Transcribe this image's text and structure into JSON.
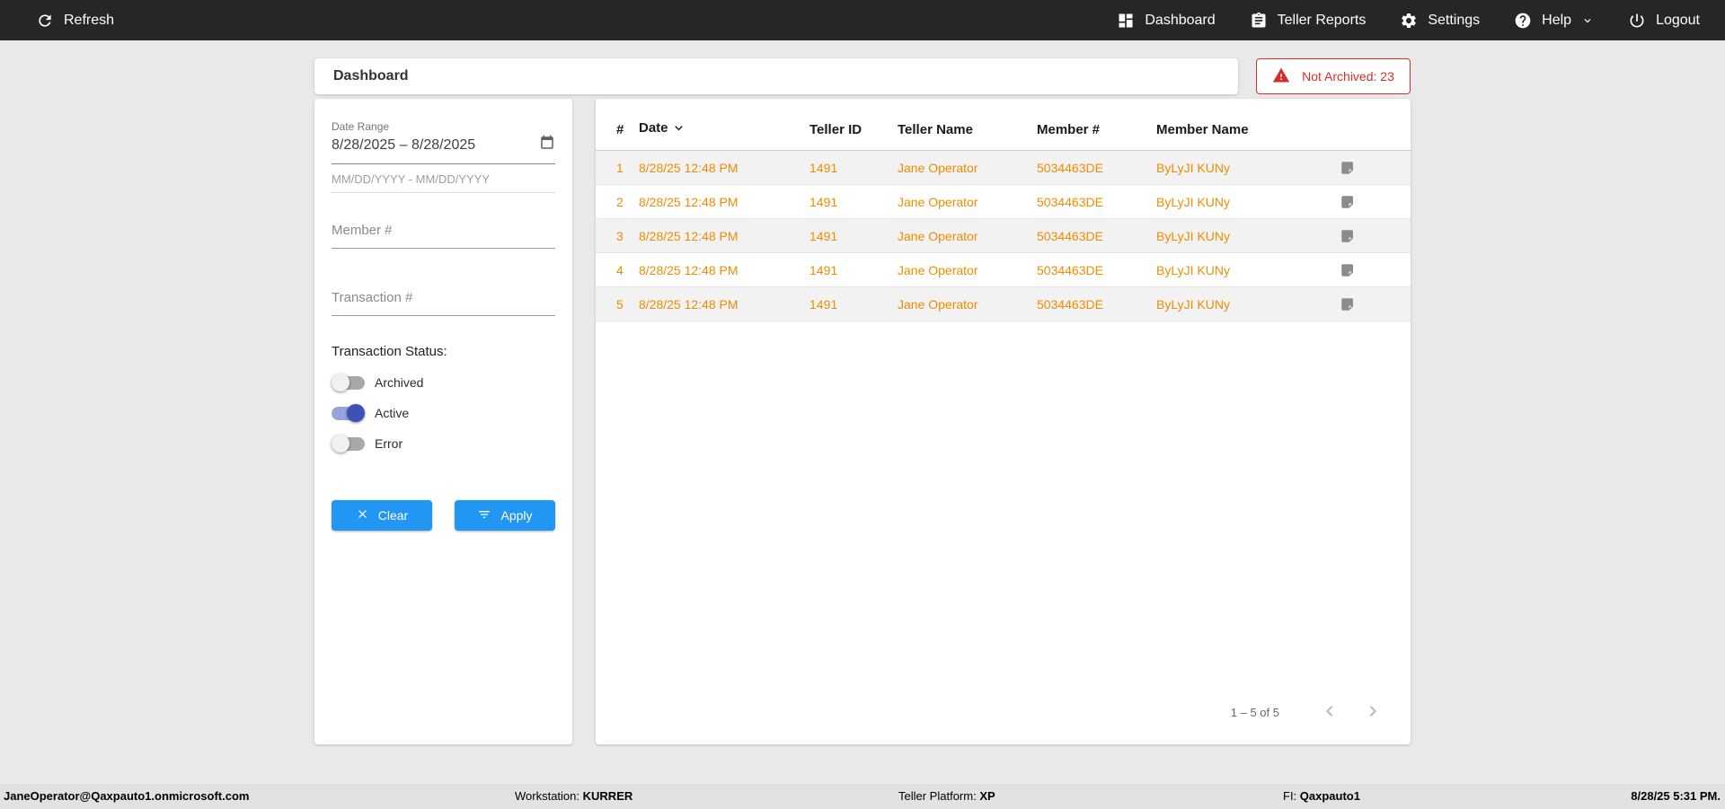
{
  "topbar": {
    "refresh_label": "Refresh",
    "nav": {
      "dashboard": "Dashboard",
      "teller_reports": "Teller Reports",
      "settings": "Settings",
      "help": "Help",
      "logout": "Logout"
    }
  },
  "header": {
    "title": "Dashboard",
    "not_archived_badge": "Not Archived: 23"
  },
  "filters": {
    "date_range_label": "Date Range",
    "date_range_value": "8/28/2025 – 8/28/2025",
    "date_range_hint": "MM/DD/YYYY - MM/DD/YYYY",
    "member_placeholder": "Member #",
    "transaction_placeholder": "Transaction #",
    "status_label": "Transaction Status:",
    "toggles": [
      {
        "label": "Archived",
        "on": false
      },
      {
        "label": "Active",
        "on": true
      },
      {
        "label": "Error",
        "on": false
      }
    ],
    "clear_label": "Clear",
    "apply_label": "Apply"
  },
  "table": {
    "columns": {
      "num": "#",
      "date": "Date",
      "teller_id": "Teller ID",
      "teller_name": "Teller Name",
      "member_num": "Member #",
      "member_name": "Member Name"
    },
    "sort_column": "Date",
    "rows": [
      {
        "num": "1",
        "date": "8/28/25 12:48 PM",
        "teller_id": "1491",
        "teller_name": "Jane Operator",
        "member_num": "5034463DE",
        "member_name": "ByLyJI KUNy"
      },
      {
        "num": "2",
        "date": "8/28/25 12:48 PM",
        "teller_id": "1491",
        "teller_name": "Jane Operator",
        "member_num": "5034463DE",
        "member_name": "ByLyJI KUNy"
      },
      {
        "num": "3",
        "date": "8/28/25 12:48 PM",
        "teller_id": "1491",
        "teller_name": "Jane Operator",
        "member_num": "5034463DE",
        "member_name": "ByLyJI KUNy"
      },
      {
        "num": "4",
        "date": "8/28/25 12:48 PM",
        "teller_id": "1491",
        "teller_name": "Jane Operator",
        "member_num": "5034463DE",
        "member_name": "ByLyJI KUNy"
      },
      {
        "num": "5",
        "date": "8/28/25 12:48 PM",
        "teller_id": "1491",
        "teller_name": "Jane Operator",
        "member_num": "5034463DE",
        "member_name": "ByLyJI KUNy"
      }
    ],
    "pagination_range": "1 – 5 of 5"
  },
  "footer": {
    "user": "JaneOperator@Qaxpauto1.onmicrosoft.com",
    "workstation_label": "Workstation:",
    "workstation_value": "KURRER",
    "platform_label": "Teller Platform:",
    "platform_value": "XP",
    "fi_label": "FI:",
    "fi_value": "Qaxpauto1",
    "datetime": "8/28/25 5:31 PM."
  },
  "colors": {
    "topbar_dark": "#262626",
    "accent_orange": "#EF8C00",
    "button_blue": "#2196F3",
    "alert_red": "#D32F2F",
    "toggle_active_blue": "#3F51B5"
  }
}
